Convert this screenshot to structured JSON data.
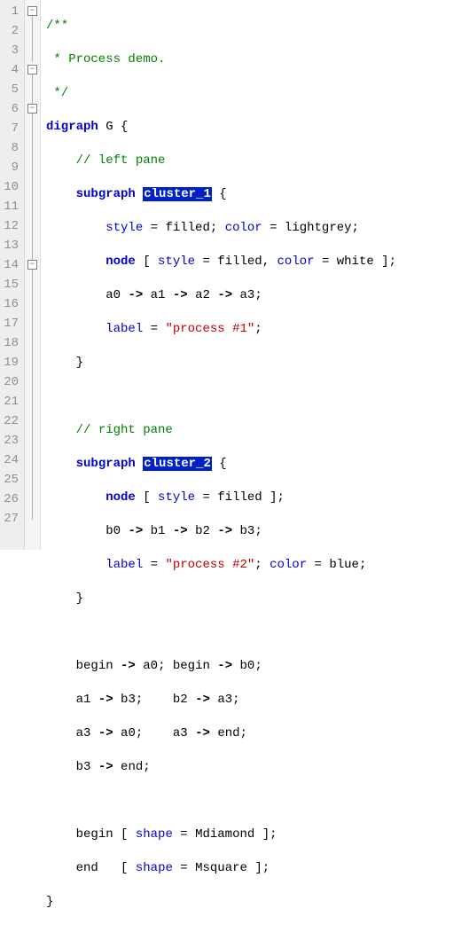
{
  "lines": {
    "l1": "/**",
    "l2": " * Process demo.",
    "l3": " */",
    "l4_kw": "digraph",
    "l4_name": "G",
    "l4_brace": "{",
    "l5": "// left pane",
    "l6_kw": "subgraph",
    "l6_name": "cluster_1",
    "l6_brace": "{",
    "l7_a1": "style",
    "l7_eq": "=",
    "l7_v1": "filled",
    "l7_sc": ";",
    "l7_a2": "color",
    "l7_v2": "lightgrey",
    "l8_kw": "node",
    "l8_lb": "[",
    "l8_a1": "style",
    "l8_v1": "filled",
    "l8_cm": ",",
    "l8_a2": "color",
    "l8_v2": "white",
    "l8_rb": "]",
    "l9_n0": "a0",
    "l9_ar": "->",
    "l9_n1": "a1",
    "l9_n2": "a2",
    "l9_n3": "a3",
    "l9_sc": ";",
    "l10_a": "label",
    "l10_eq": "=",
    "l10_s": "\"process #1\"",
    "l10_sc": ";",
    "l11": "}",
    "l13": "// right pane",
    "l14_kw": "subgraph",
    "l14_name": "cluster_2",
    "l14_brace": "{",
    "l15_kw": "node",
    "l15_lb": "[",
    "l15_a1": "style",
    "l15_v1": "filled",
    "l15_rb": "]",
    "l15_sc": ";",
    "l16_n0": "b0",
    "l16_ar": "->",
    "l16_n1": "b1",
    "l16_n2": "b2",
    "l16_n3": "b3",
    "l16_sc": ";",
    "l17_a": "label",
    "l17_s": "\"process #2\"",
    "l17_sc": ";",
    "l17_a2": "color",
    "l17_v2": "blue",
    "l18": "}",
    "l20_e1a": "begin",
    "l20_ar": "->",
    "l20_e1b": "a0",
    "l20_sc": ";",
    "l20_e2a": "begin",
    "l20_e2b": "b0",
    "l21_e1a": "a1",
    "l21_e1b": "b3",
    "l21_e2a": "b2",
    "l21_e2b": "a3",
    "l22_e1a": "a3",
    "l22_e1b": "a0",
    "l22_e2a": "a3",
    "l22_e2b": "end",
    "l23_e1a": "b3",
    "l23_e1b": "end",
    "l25_n": "begin",
    "l25_lb": "[",
    "l25_a": "shape",
    "l25_eq": "=",
    "l25_v": "Mdiamond",
    "l25_rb": "]",
    "l25_sc": ";",
    "l26_n": "end",
    "l26_a": "shape",
    "l26_v": "Msquare",
    "l27": "}"
  },
  "line_numbers": [
    "1",
    "2",
    "3",
    "4",
    "5",
    "6",
    "7",
    "8",
    "9",
    "10",
    "11",
    "12",
    "13",
    "14",
    "15",
    "16",
    "17",
    "18",
    "19",
    "20",
    "21",
    "22",
    "23",
    "24",
    "25",
    "26",
    "27"
  ]
}
